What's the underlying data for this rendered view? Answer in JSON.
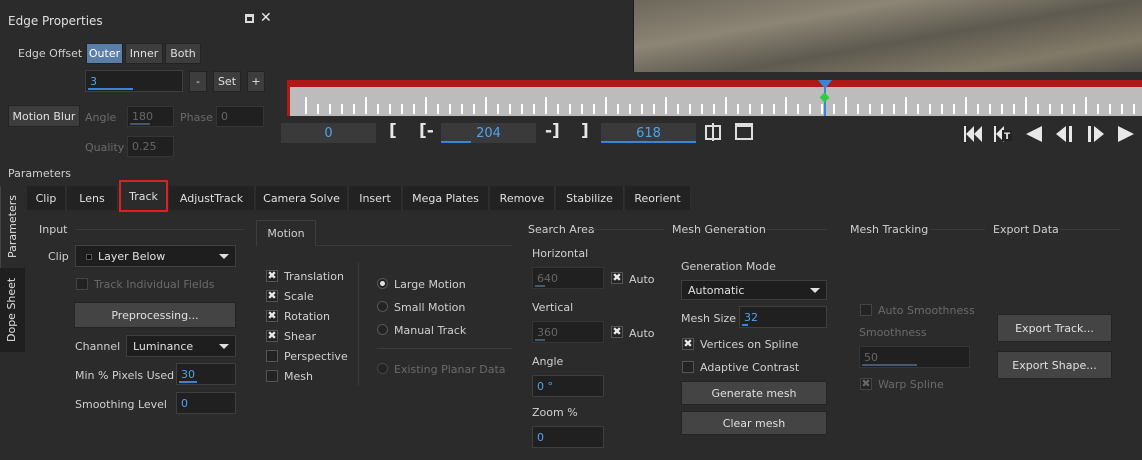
{
  "edge_panel": {
    "title": "Edge Properties",
    "edge_offset_label": "Edge Offset",
    "outer": "Outer",
    "inner": "Inner",
    "both": "Both",
    "offset_value": "3",
    "minus": "-",
    "set": "Set",
    "plus": "+",
    "motion_blur": "Motion Blur",
    "angle_label": "Angle",
    "angle_value": "180",
    "phase_label": "Phase",
    "phase_value": "0",
    "quality_label": "Quality",
    "quality_value": "0.25"
  },
  "timeline": {
    "start": "0",
    "in_point": "204",
    "out_point": "618",
    "bracket_open": "[",
    "in_prefix": "[-",
    "in_suffix": "-]",
    "bracket_close": "]"
  },
  "parameters_label": "Parameters",
  "side_tabs": [
    "Parameters",
    "Dope Sheet"
  ],
  "tabs": [
    "Clip",
    "Lens",
    "Track",
    "AdjustTrack",
    "Camera Solve",
    "Insert",
    "Mega Plates",
    "Remove",
    "Stabilize",
    "Reorient"
  ],
  "input": {
    "header": "Input",
    "clip_label": "Clip",
    "clip_value": "Layer Below",
    "track_individual": "Track Individual Fields",
    "preprocessing": "Preprocessing...",
    "channel_label": "Channel",
    "channel_value": "Luminance",
    "min_pixels_label": "Min % Pixels Used",
    "min_pixels_value": "30",
    "smoothing_label": "Smoothing Level",
    "smoothing_value": "0"
  },
  "motion": {
    "tab": "Motion",
    "checks": [
      {
        "label": "Translation",
        "checked": true
      },
      {
        "label": "Scale",
        "checked": true
      },
      {
        "label": "Rotation",
        "checked": true
      },
      {
        "label": "Shear",
        "checked": true
      },
      {
        "label": "Perspective",
        "checked": false
      },
      {
        "label": "Mesh",
        "checked": false
      }
    ],
    "radios": [
      "Large Motion",
      "Small Motion",
      "Manual Track"
    ],
    "existing_planar": "Existing Planar Data"
  },
  "search_area": {
    "header": "Search Area",
    "horizontal_label": "Horizontal",
    "horizontal_value": "640",
    "auto": "Auto",
    "vertical_label": "Vertical",
    "vertical_value": "360",
    "angle_label": "Angle",
    "angle_value": "0 °",
    "zoom_label": "Zoom %",
    "zoom_value": "0"
  },
  "mesh_generation": {
    "header": "Mesh Generation",
    "mode_label": "Generation Mode",
    "mode_value": "Automatic",
    "mesh_size_label": "Mesh Size",
    "mesh_size_value": "32",
    "vertices_on_spline": "Vertices on Spline",
    "adaptive_contrast": "Adaptive Contrast",
    "generate": "Generate mesh",
    "clear": "Clear mesh"
  },
  "mesh_tracking": {
    "header": "Mesh Tracking",
    "auto_smoothness": "Auto Smoothness",
    "smoothness_label": "Smoothness",
    "smoothness_value": "50",
    "warp_spline": "Warp Spline"
  },
  "export_data": {
    "header": "Export Data",
    "export_track": "Export Track...",
    "export_shape": "Export Shape..."
  },
  "colors": {
    "accent": "#3a86d4",
    "highlight": "#e02020",
    "active_button": "#5b7ea8"
  }
}
